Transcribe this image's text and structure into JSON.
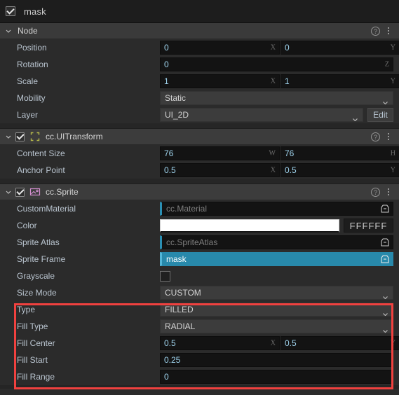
{
  "node": {
    "enabled_checkbox": "checked",
    "name": "mask"
  },
  "sections": {
    "node": {
      "title": "Node",
      "help_icon": "help-circle-icon",
      "menu_icon": "kebab-menu-icon"
    },
    "ui_transform": {
      "title": "cc.UITransform",
      "icon": "ui-transform-icon",
      "enabled_checkbox": "checked",
      "help_icon": "help-circle-icon",
      "menu_icon": "kebab-menu-icon"
    },
    "sprite": {
      "title": "cc.Sprite",
      "icon": "sprite-image-icon",
      "enabled_checkbox": "checked",
      "help_icon": "help-circle-icon",
      "menu_icon": "kebab-menu-icon"
    }
  },
  "node_props": {
    "position": {
      "label": "Position",
      "x": "0",
      "y": "0",
      "x_suffix": "X",
      "y_suffix": "Y"
    },
    "rotation": {
      "label": "Rotation",
      "z": "0",
      "z_suffix": "Z"
    },
    "scale": {
      "label": "Scale",
      "x": "1",
      "y": "1",
      "x_suffix": "X",
      "y_suffix": "Y"
    },
    "mobility": {
      "label": "Mobility",
      "value": "Static"
    },
    "layer": {
      "label": "Layer",
      "value": "UI_2D",
      "edit_button": "Edit"
    }
  },
  "ui_transform_props": {
    "content_size": {
      "label": "Content Size",
      "w": "76",
      "h": "76",
      "w_suffix": "W",
      "h_suffix": "H"
    },
    "anchor_point": {
      "label": "Anchor Point",
      "x": "0.5",
      "y": "0.5",
      "x_suffix": "X",
      "y_suffix": "Y"
    }
  },
  "sprite_props": {
    "custom_material": {
      "label": "CustomMaterial",
      "placeholder": "cc.Material",
      "locate_icon": "asset-locate-icon"
    },
    "color": {
      "label": "Color",
      "swatch": "#FFFFFF",
      "hex": "FFFFFF"
    },
    "sprite_atlas": {
      "label": "Sprite Atlas",
      "placeholder": "cc.SpriteAtlas",
      "locate_icon": "asset-locate-icon"
    },
    "sprite_frame": {
      "label": "Sprite Frame",
      "value": "mask",
      "locate_icon": "asset-locate-icon"
    },
    "grayscale": {
      "label": "Grayscale",
      "checked": false
    },
    "size_mode": {
      "label": "Size Mode",
      "value": "CUSTOM"
    },
    "type": {
      "label": "Type",
      "value": "FILLED"
    },
    "fill_type": {
      "label": "Fill Type",
      "value": "RADIAL"
    },
    "fill_center": {
      "label": "Fill Center",
      "x": "0.5",
      "y": "0.5",
      "x_suffix": "X",
      "y_suffix": "Y"
    },
    "fill_start": {
      "label": "Fill Start",
      "value": "0.25"
    },
    "fill_range": {
      "label": "Fill Range",
      "value": "0"
    }
  },
  "highlight": {
    "name": "fill-properties-highlight",
    "color": "#F0413F"
  }
}
